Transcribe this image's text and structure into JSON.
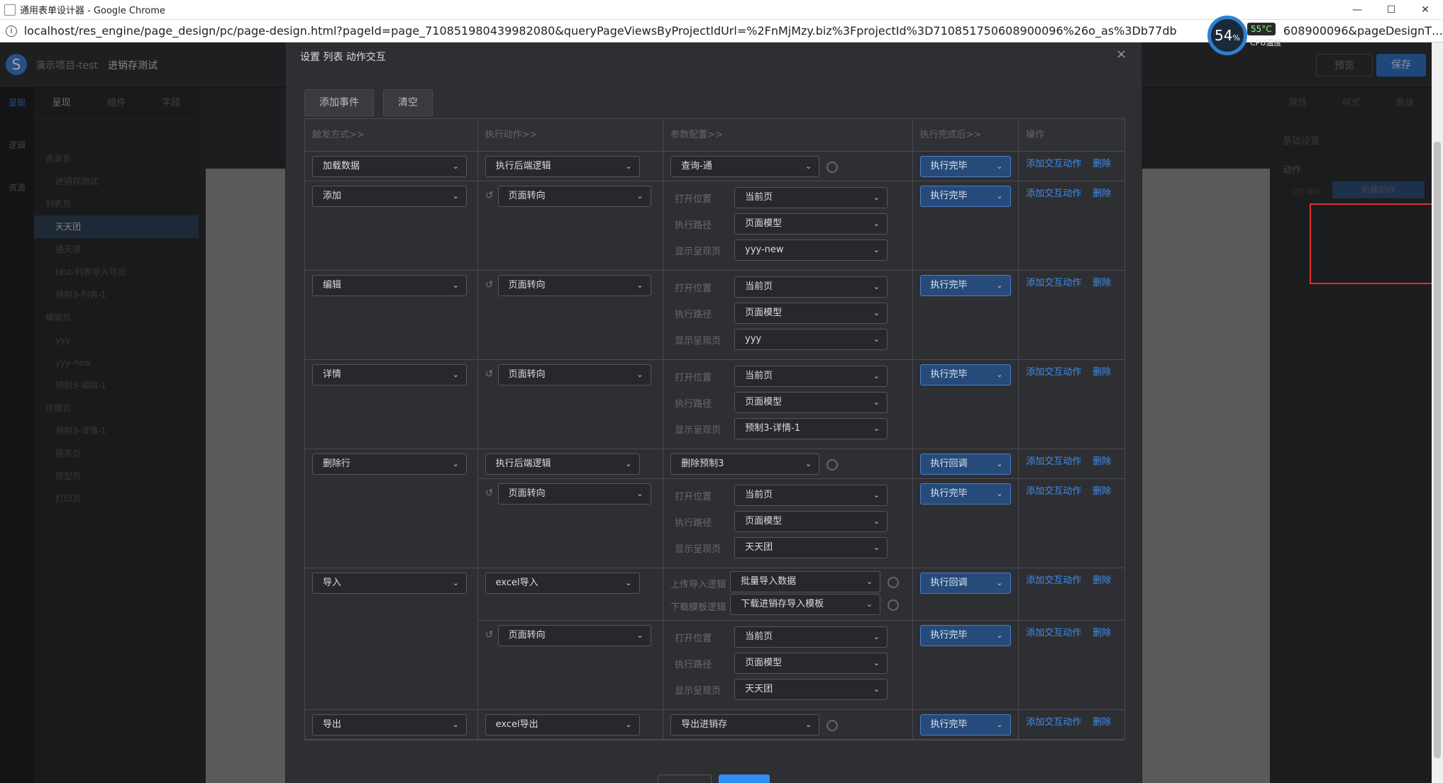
{
  "browser": {
    "title": "通用表单设计器 - Google Chrome",
    "url": "localhost/res_engine/page_design/pc/page-design.html?pageId=page_710851980439982080&queryPageViewsByProjectIdUrl=%2FnMjMzy.biz%3FprojectId%3D710851750608900096%26o_as%3Db77db2a0bdbca6ba1404f18bc871b4b68647c06f&pr",
    "url_tail": "608900096&pageDesignT…",
    "min": "—",
    "max": "☐",
    "close": "✕"
  },
  "cpu": {
    "percent": "54",
    "unit": "%",
    "temp": "55°C",
    "label": "CPU温度"
  },
  "app": {
    "logo": "S",
    "project": "演示项目-test",
    "page": "进销存测试",
    "preview": "预览",
    "save": "保存",
    "sidebar": [
      "呈现",
      "逻辑",
      "资源"
    ],
    "panel_tabs": [
      "呈现",
      "组件",
      "字段"
    ],
    "tree": [
      "表单页",
      "进销存测试",
      "列表页",
      "天天团",
      "通天塔",
      "test-列表导入导出",
      "预制3-列表-1",
      "编辑页",
      "yyy",
      "yyy-new",
      "预制3-编辑-1",
      "详情页",
      "预制3-详情-1",
      "报表页",
      "原型页",
      "打印页"
    ],
    "right_tabs": [
      "属性",
      "样式",
      "高级"
    ],
    "right_basic": "基础设置",
    "right_action": "动作",
    "right_event": "动作事件",
    "right_new": "新建动作"
  },
  "modal": {
    "title": "设置 列表 动作交互",
    "close": "×",
    "add_event": "添加事件",
    "clear": "清空",
    "headers": [
      "触发方式>>",
      "执行动作>>",
      "参数配置>>",
      "执行完成后>>",
      "操作"
    ],
    "add_link": "添加交互动作",
    "del_link": "删除",
    "param_labels": {
      "open": "打开位置",
      "path": "执行路径",
      "page": "显示呈现页",
      "upload": "上传导入逻辑",
      "download": "下载模板逻辑"
    },
    "rows": [
      {
        "trigger": "加载数据",
        "actions": [
          {
            "action": "执行后端逻辑",
            "type": "simple",
            "value": "查询-通",
            "after": "执行完毕"
          }
        ]
      },
      {
        "trigger": "添加",
        "actions": [
          {
            "action": "页面转向",
            "type": "nav",
            "open": "当前页",
            "path": "页面模型",
            "page": "yyy-new",
            "after": "执行完毕"
          }
        ]
      },
      {
        "trigger": "编辑",
        "actions": [
          {
            "action": "页面转向",
            "type": "nav",
            "open": "当前页",
            "path": "页面模型",
            "page": "yyy",
            "after": "执行完毕"
          }
        ]
      },
      {
        "trigger": "详情",
        "actions": [
          {
            "action": "页面转向",
            "type": "nav",
            "open": "当前页",
            "path": "页面模型",
            "page": "预制3-详情-1",
            "after": "执行完毕"
          }
        ]
      },
      {
        "trigger": "删除行",
        "actions": [
          {
            "action": "执行后端逻辑",
            "type": "simple",
            "value": "删除预制3",
            "after": "执行回调"
          },
          {
            "action": "页面转向",
            "type": "nav",
            "open": "当前页",
            "path": "页面模型",
            "page": "天天团",
            "after": "执行完毕"
          }
        ]
      },
      {
        "trigger": "导入",
        "actions": [
          {
            "action": "excel导入",
            "type": "import",
            "upload": "批量导入数据",
            "download": "下载进销存导入模板",
            "after": "执行回调"
          },
          {
            "action": "页面转向",
            "type": "nav",
            "open": "当前页",
            "path": "页面模型",
            "page": "天天团",
            "after": "执行完毕"
          }
        ]
      },
      {
        "trigger": "导出",
        "actions": [
          {
            "action": "excel导出",
            "type": "simple",
            "value": "导出进销存",
            "after": "执行完毕"
          }
        ]
      }
    ]
  },
  "icons": {
    "arrow": "chevron-down-icon",
    "gear": "gear-icon",
    "loop": "loop-arrow-icon"
  }
}
